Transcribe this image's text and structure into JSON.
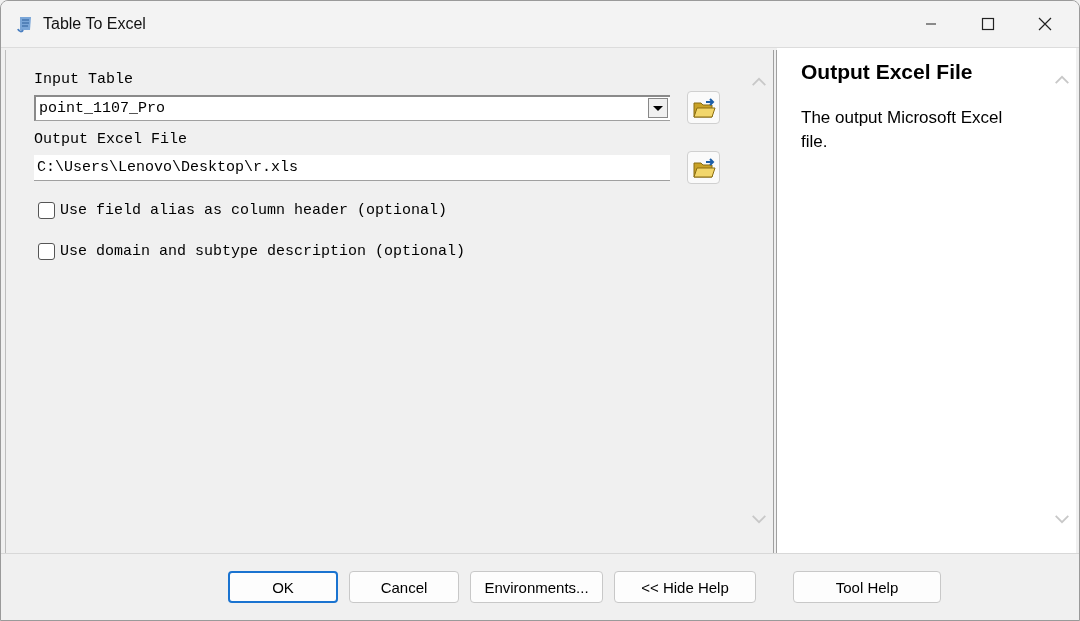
{
  "window": {
    "title": "Table To Excel"
  },
  "parameters": [
    {
      "kind": "dropdown",
      "label": "Input Table",
      "value": "point_1107_Pro"
    },
    {
      "kind": "path",
      "label": "Output Excel File",
      "value": "C:\\Users\\Lenovo\\Desktop\\r.xls"
    },
    {
      "kind": "checkbox",
      "label": "Use field alias as column header (optional)",
      "checked": false
    },
    {
      "kind": "checkbox",
      "label": "Use domain and subtype description (optional)",
      "checked": false
    }
  ],
  "help": {
    "title": "Output Excel File",
    "text": "The output Microsoft Excel file."
  },
  "buttons": [
    {
      "label": "OK",
      "default": true
    },
    {
      "label": "Cancel",
      "default": false
    },
    {
      "label": "Environments...",
      "default": false
    },
    {
      "label": "<< Hide Help",
      "default": false
    },
    {
      "label": "Tool Help",
      "default": false
    }
  ]
}
